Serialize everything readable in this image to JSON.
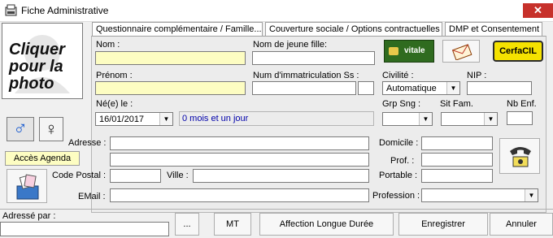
{
  "window": {
    "title": "Fiche Administrative",
    "close_glyph": "✕"
  },
  "tabs": [
    {
      "label": "Questionnaire complémentaire / Famille..."
    },
    {
      "label": "Couverture sociale / Options contractuelles"
    },
    {
      "label": "DMP et Consentement"
    }
  ],
  "photo": {
    "label": "Cliquer pour la photo"
  },
  "fields": {
    "nom": {
      "label": "Nom :",
      "value": ""
    },
    "nom_jeune_fille": {
      "label": "Nom de jeune fille:",
      "value": ""
    },
    "prenom": {
      "label": "Prénom :",
      "value": ""
    },
    "immatriculation": {
      "label": "Num d'immatriculation Ss :",
      "value": ""
    },
    "civilite": {
      "label": "Civilité :",
      "value": "Automatique"
    },
    "nip": {
      "label": "NIP :",
      "value": ""
    },
    "naissance": {
      "label": "Né(e) le :",
      "value": "16/01/2017",
      "age": "0 mois et un jour"
    },
    "grp_sng": {
      "label": "Grp Sng :",
      "value": ""
    },
    "sit_fam": {
      "label": "Sit Fam.",
      "value": ""
    },
    "nb_enf": {
      "label": "Nb Enf.",
      "value": ""
    },
    "adresse": {
      "label": "Adresse :",
      "value": ""
    },
    "domicile": {
      "label": "Domicile :",
      "value": ""
    },
    "prof": {
      "label": "Prof. :",
      "value": ""
    },
    "code_postal": {
      "label": "Code Postal :",
      "value": ""
    },
    "ville": {
      "label": "Ville :",
      "value": ""
    },
    "portable": {
      "label": "Portable :",
      "value": ""
    },
    "email": {
      "label": "EMail :",
      "value": ""
    },
    "profession": {
      "label": "Profession :",
      "value": ""
    },
    "adresse_par": {
      "label": "Adressé par :",
      "value": ""
    }
  },
  "buttons": {
    "vitale": "vitale",
    "cerfacil": "CerfaCIL",
    "acces_agenda": "Accès Agenda",
    "browse": "...",
    "mt": "MT",
    "ald": "Affection Longue Durée",
    "save": "Enregistrer",
    "cancel": "Annuler"
  },
  "gender": {
    "male_glyph": "♂",
    "female_glyph": "♀"
  },
  "colors": {
    "accent_yellow": "#fdfdc2",
    "link_blue": "#0000aa",
    "male_blue": "#1f5fd0",
    "close_red": "#c7312b"
  }
}
